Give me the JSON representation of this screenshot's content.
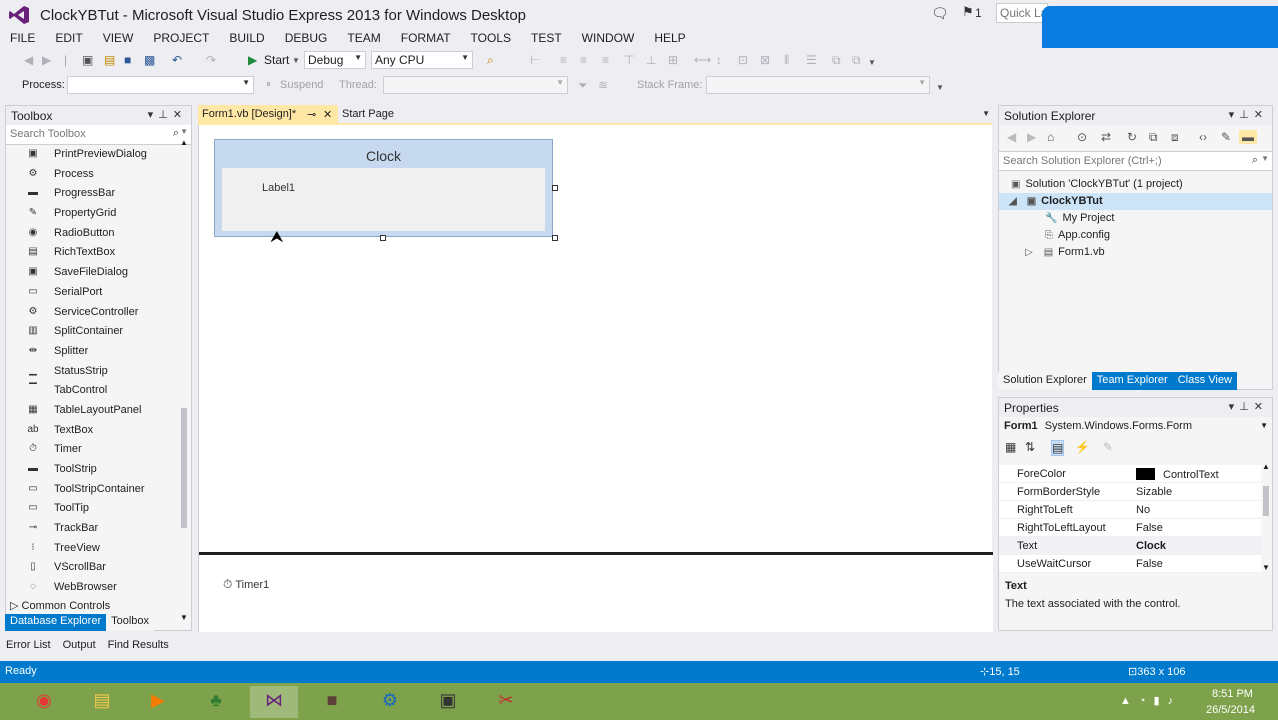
{
  "window": {
    "title": "ClockYBTut - Microsoft Visual Studio Express 2013 for Windows Desktop",
    "feedback_count": "1",
    "quick_launch_placeholder": "Quick La"
  },
  "menu": [
    "FILE",
    "EDIT",
    "VIEW",
    "PROJECT",
    "BUILD",
    "DEBUG",
    "TEAM",
    "FORMAT",
    "TOOLS",
    "TEST",
    "WINDOW",
    "HELP"
  ],
  "toolbar": {
    "start_label": "Start",
    "config": "Debug",
    "platform": "Any CPU",
    "process_label": "Process:",
    "suspend_label": "Suspend",
    "thread_label": "Thread:",
    "stack_frame_label": "Stack Frame:"
  },
  "toolbox": {
    "title": "Toolbox",
    "search_placeholder": "Search Toolbox",
    "items": [
      {
        "label": "PrintPreviewDialog",
        "icon": "▣"
      },
      {
        "label": "Process",
        "icon": "⚙"
      },
      {
        "label": "ProgressBar",
        "icon": "▬"
      },
      {
        "label": "PropertyGrid",
        "icon": "✎"
      },
      {
        "label": "RadioButton",
        "icon": "◉"
      },
      {
        "label": "RichTextBox",
        "icon": "▤"
      },
      {
        "label": "SaveFileDialog",
        "icon": "▣"
      },
      {
        "label": "SerialPort",
        "icon": "▭"
      },
      {
        "label": "ServiceController",
        "icon": "⚙"
      },
      {
        "label": "SplitContainer",
        "icon": "▥"
      },
      {
        "label": "Splitter",
        "icon": "⇹"
      },
      {
        "label": "StatusStrip",
        "icon": "▁"
      },
      {
        "label": "TabControl",
        "icon": "▔"
      },
      {
        "label": "TableLayoutPanel",
        "icon": "▦"
      },
      {
        "label": "TextBox",
        "icon": "ab"
      },
      {
        "label": "Timer",
        "icon": "⏱"
      },
      {
        "label": "ToolStrip",
        "icon": "▬"
      },
      {
        "label": "ToolStripContainer",
        "icon": "▭"
      },
      {
        "label": "ToolTip",
        "icon": "▭"
      },
      {
        "label": "TrackBar",
        "icon": "⊸"
      },
      {
        "label": "TreeView",
        "icon": "⁝"
      },
      {
        "label": "VScrollBar",
        "icon": "▯"
      },
      {
        "label": "WebBrowser",
        "icon": "◌"
      }
    ],
    "group": "Common Controls",
    "bottom_tabs": [
      "Database Explorer",
      "Toolbox"
    ]
  },
  "editor": {
    "tabs": [
      "Form1.vb [Design]*",
      "Start Page"
    ],
    "form_title": "Clock",
    "label_text": "Label1",
    "tray_component": "Timer1"
  },
  "solution_explorer": {
    "title": "Solution Explorer",
    "search_placeholder": "Search Solution Explorer (Ctrl+;)",
    "solution": "Solution 'ClockYBTut' (1 project)",
    "project": "ClockYBTut",
    "items": [
      "My Project",
      "App.config",
      "Form1.vb"
    ],
    "bottom_tabs": [
      "Solution Explorer",
      "Team Explorer",
      "Class View"
    ]
  },
  "properties": {
    "title": "Properties",
    "object_name": "Form1",
    "object_type": "System.Windows.Forms.Form",
    "rows": [
      {
        "name": "ForeColor",
        "value": "ControlText"
      },
      {
        "name": "FormBorderStyle",
        "value": "Sizable"
      },
      {
        "name": "RightToLeft",
        "value": "No"
      },
      {
        "name": "RightToLeftLayout",
        "value": "False"
      },
      {
        "name": "Text",
        "value": "Clock"
      },
      {
        "name": "UseWaitCursor",
        "value": "False"
      }
    ],
    "desc_title": "Text",
    "desc_text": "The text associated with the control."
  },
  "output_tabs": [
    "Error List",
    "Output",
    "Find Results"
  ],
  "status": {
    "text": "Ready",
    "position": "15, 15",
    "size": "363 x 106"
  },
  "taskbar": {
    "time": "8:51 PM",
    "date": "26/5/2014"
  },
  "colors": {
    "accent": "#007acc",
    "active_tab": "#ffe8a6",
    "taskbar": "#7ea24c"
  }
}
